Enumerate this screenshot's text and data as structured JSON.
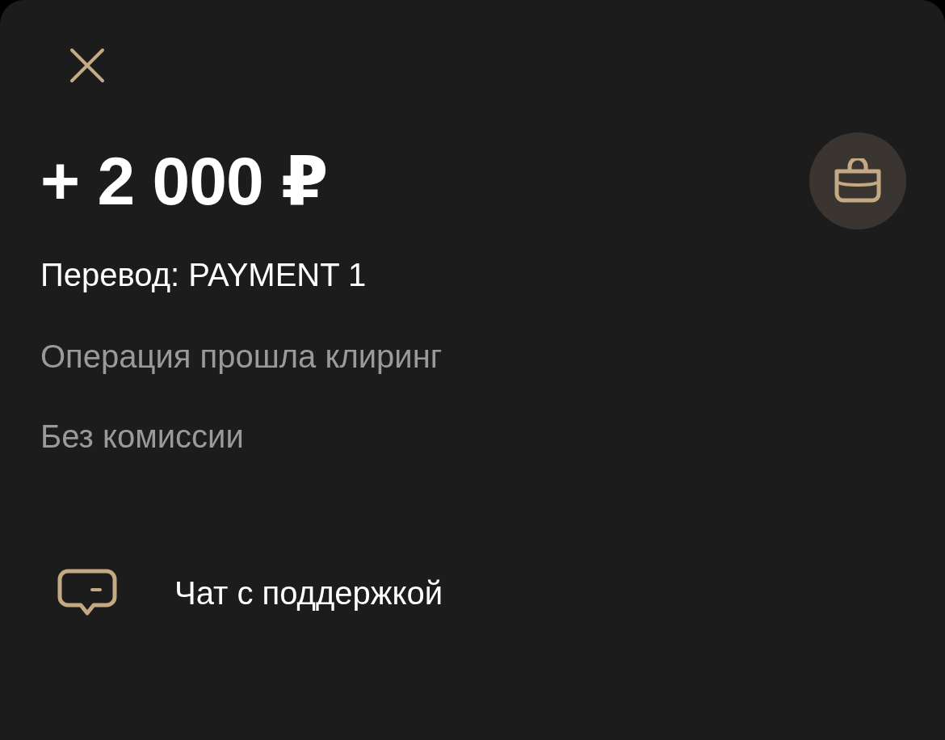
{
  "amount": "+ 2 000 ₽",
  "title": "Перевод: PAYMENT 1",
  "details": [
    "Операция прошла клиринг",
    "Без комиссии"
  ],
  "actions": [
    {
      "kind": "chat",
      "label": "Чат с поддержкой"
    }
  ]
}
